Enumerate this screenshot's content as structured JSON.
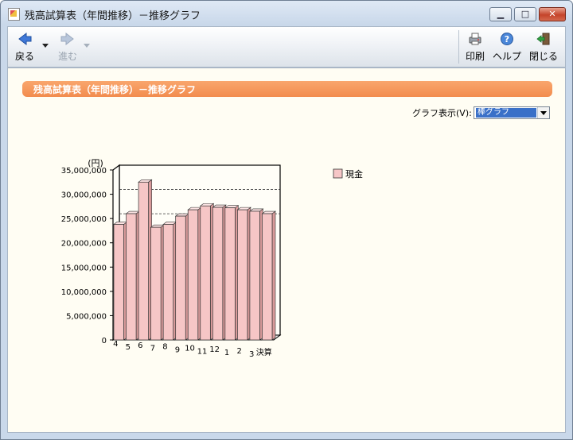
{
  "window": {
    "title": "残高試算表（年間推移）－推移グラフ",
    "controls": {
      "minimize": "▁",
      "maximize": "□",
      "close": "✕"
    }
  },
  "toolbar": {
    "back_label": "戻る",
    "forward_label": "進む",
    "print_label": "印刷",
    "help_label": "ヘルプ",
    "close_label": "閉じる"
  },
  "page": {
    "header": "残高試算表（年間推移）－推移グラフ",
    "graph_display_label": "グラフ表示(V):",
    "graph_display_value": "棒グラフ"
  },
  "colors": {
    "header_band": "#f28c4e",
    "bar_fill": "#f6c6c6",
    "bar_side": "#d89a9a",
    "background": "#fffdf3"
  },
  "icons": {
    "back": "left-arrow-icon",
    "forward": "right-arrow-icon",
    "print": "printer-icon",
    "help": "help-icon",
    "close": "door-exit-icon"
  },
  "chart_data": {
    "type": "bar",
    "unit_label": "(円)",
    "categories": [
      "4",
      "5",
      "6",
      "7",
      "8",
      "9",
      "10",
      "11",
      "12",
      "1",
      "2",
      "3",
      "決算"
    ],
    "series": [
      {
        "name": "現金",
        "values": [
          23800000,
          26000000,
          32500000,
          23200000,
          23800000,
          25500000,
          26800000,
          27600000,
          27300000,
          27200000,
          26800000,
          26500000,
          26000000
        ]
      }
    ],
    "ylim": [
      0,
      35000000
    ],
    "yticks": [
      "0",
      "5,000,000",
      "10,000,000",
      "15,000,000",
      "20,000,000",
      "25,000,000",
      "30,000,000",
      "35,000,000"
    ],
    "legend_position": "top-right",
    "style": "3d",
    "grid": false
  }
}
